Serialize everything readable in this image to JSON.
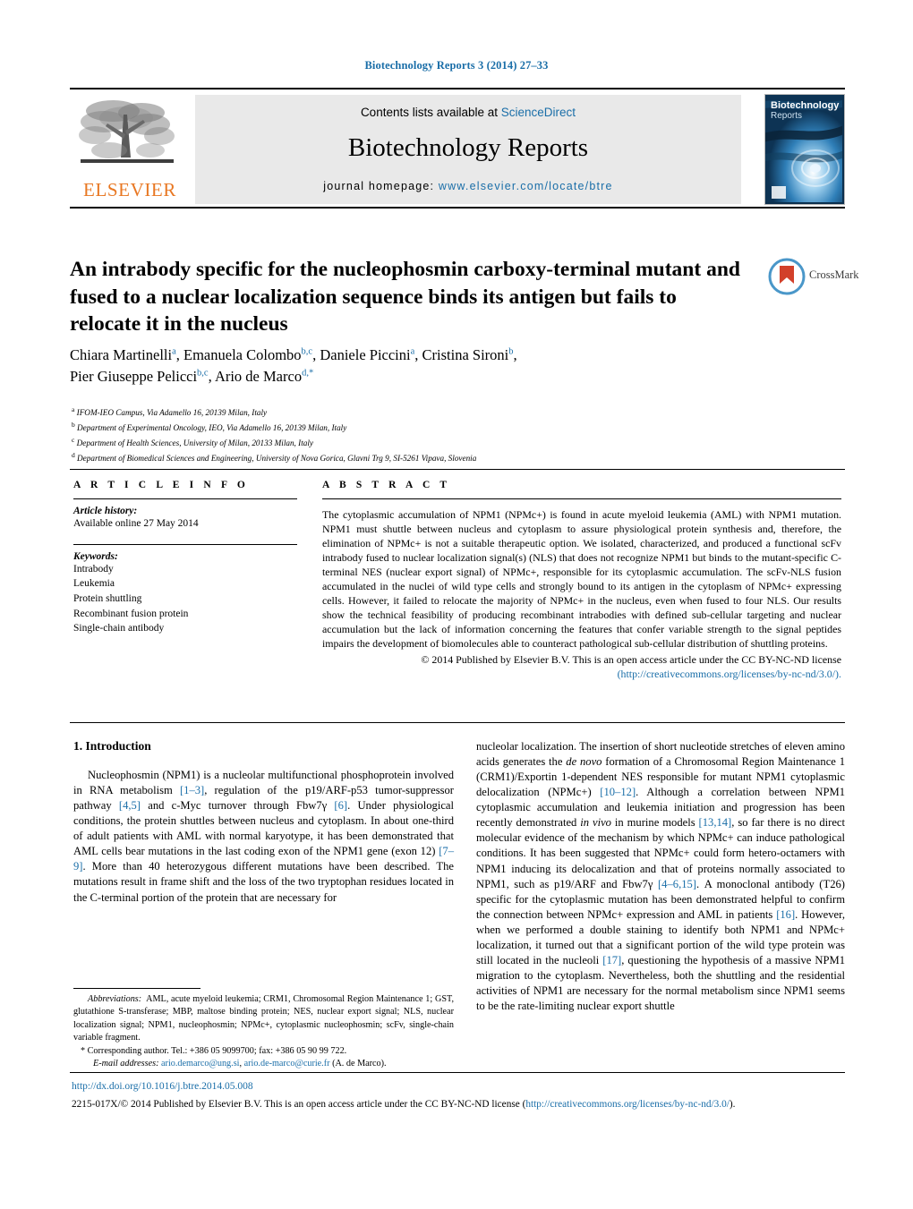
{
  "running_head": "Biotechnology Reports 3 (2014) 27–33",
  "masthead": {
    "publisher_name": "ELSEVIER",
    "contents_prefix": "Contents lists available at ",
    "contents_link": "ScienceDirect",
    "journal_title": "Biotechnology Reports",
    "homepage_label": "journal homepage:",
    "homepage_url": "www.elsevier.com/locate/btre",
    "cover_title_line1": "Biotechnology",
    "cover_title_line2": "Reports"
  },
  "article": {
    "title": "An intrabody specific for the nucleophosmin carboxy-terminal mutant and fused to a nuclear localization sequence binds its antigen but fails to relocate it in the nucleus",
    "crossmark_label": "CrossMark",
    "authors_line1_parts": [
      {
        "name": "Chiara Martinelli",
        "sup": "a",
        "sep": ", "
      },
      {
        "name": "Emanuela Colombo",
        "sup": "b,c",
        "sep": ", "
      },
      {
        "name": "Daniele Piccini",
        "sup": "a",
        "sep": ", "
      },
      {
        "name": "Cristina Sironi",
        "sup": "b",
        "sep": ","
      }
    ],
    "authors_line2_parts": [
      {
        "name": "Pier Giuseppe Pelicci",
        "sup": "b,c",
        "sep": ", "
      },
      {
        "name": "Ario de Marco",
        "sup": "d,*",
        "sep": ""
      }
    ],
    "affiliations": [
      {
        "mark": "a",
        "text": "IFOM-IEO Campus, Via Adamello 16, 20139 Milan, Italy"
      },
      {
        "mark": "b",
        "text": "Department of Experimental Oncology, IEO, Via Adamello 16, 20139 Milan, Italy"
      },
      {
        "mark": "c",
        "text": "Department of Health Sciences, University of Milan, 20133 Milan, Italy"
      },
      {
        "mark": "d",
        "text": "Department of Biomedical Sciences and Engineering, University of Nova Gorica, Glavni Trg 9, SI-5261 Vipava, Slovenia"
      }
    ]
  },
  "article_info": {
    "heading": "A R T I C L E   I N F O",
    "history_label": "Article history:",
    "history_value": "Available online 27 May 2014",
    "keywords_label": "Keywords:",
    "keywords": [
      "Intrabody",
      "Leukemia",
      "Protein shuttling",
      "Recombinant fusion protein",
      "Single-chain antibody"
    ]
  },
  "abstract": {
    "heading": "A B S T R A C T",
    "text": "The cytoplasmic accumulation of NPM1 (NPMc+) is found in acute myeloid leukemia (AML) with NPM1 mutation. NPM1 must shuttle between nucleus and cytoplasm to assure physiological protein synthesis and, therefore, the elimination of NPMc+ is not a suitable therapeutic option. We isolated, characterized, and produced a functional scFv intrabody fused to nuclear localization signal(s) (NLS) that does not recognize NPM1 but binds to the mutant-specific C-terminal NES (nuclear export signal) of NPMc+, responsible for its cytoplasmic accumulation. The scFv-NLS fusion accumulated in the nuclei of wild type cells and strongly bound to its antigen in the cytoplasm of NPMc+ expressing cells. However, it failed to relocate the majority of NPMc+ in the nucleus, even when fused to four NLS. Our results show the technical feasibility of producing recombinant intrabodies with defined sub-cellular targeting and nuclear accumulation but the lack of information concerning the features that confer variable strength to the signal peptides impairs the development of biomolecules able to counteract pathological sub-cellular distribution of shuttling proteins.",
    "copyright": "© 2014 Published by Elsevier B.V. This is an open access article under the CC BY-NC-ND license",
    "license_url": "(http://creativecommons.org/licenses/by-nc-nd/3.0/)."
  },
  "introduction": {
    "heading": "1.  Introduction",
    "left_paragraph": "Nucleophosmin (NPM1) is a nucleolar multifunctional phosphoprotein involved in RNA metabolism [1–3], regulation of the p19/ARF-p53 tumor-suppressor pathway [4,5] and c-Myc turnover through Fbw7γ [6]. Under physiological conditions, the protein shuttles between nucleus and cytoplasm. In about one-third of adult patients with AML with normal karyotype, it has been demonstrated that AML cells bear mutations in the last coding exon of the NPM1 gene (exon 12) [7–9]. More than 40 heterozygous different mutations have been described. The mutations result in frame shift and the loss of the two tryptophan residues located in the C-terminal portion of the protein that are necessary for",
    "right_paragraph": "nucleolar localization. The insertion of short nucleotide stretches of eleven amino acids generates the de novo formation of a Chromosomal Region Maintenance 1 (CRM1)/Exportin 1-dependent NES responsible for mutant NPM1 cytoplasmic delocalization (NPMc+) [10–12]. Although a correlation between NPM1 cytoplasmic accumulation and leukemia initiation and progression has been recently demonstrated in vivo in murine models [13,14], so far there is no direct molecular evidence of the mechanism by which NPMc+ can induce pathological conditions. It has been suggested that NPMc+ could form hetero-octamers with NPM1 inducing its delocalization and that of proteins normally associated to NPM1, such as p19/ARF and Fbw7γ [4–6,15]. A monoclonal antibody (T26) specific for the cytoplasmic mutation has been demonstrated helpful to confirm the connection between NPMc+ expression and AML in patients [16]. However, when we performed a double staining to identify both NPM1 and NPMc+ localization, it turned out that a significant portion of the wild type protein was still located in the nucleoli [17], questioning the hypothesis of a massive NPM1 migration to the cytoplasm. Nevertheless, both the shuttling and the residential activities of NPM1 are necessary for the normal metabolism since NPM1 seems to be the rate-limiting nuclear export shuttle"
  },
  "footnotes": {
    "abbrev_label": "Abbreviations:",
    "abbrev_text": "AML, acute myeloid leukemia; CRM1, Chromosomal Region Maintenance 1; GST, glutathione S-transferase; MBP, maltose binding protein; NES, nuclear export signal; NLS, nuclear localization signal; NPM1, nucleophosmin; NPMc+, cytoplasmic nucleophosmin; scFv, single-chain variable fragment.",
    "corresponding": "* Corresponding author. Tel.: +386 05 9099700; fax: +386 05 90 99 722.",
    "email_label": "E-mail addresses:",
    "email1": "ario.demarco@ung.si",
    "email2": "ario.de-marco@curie.fr",
    "email_suffix": " (A. de Marco)."
  },
  "footer": {
    "doi": "http://dx.doi.org/10.1016/j.btre.2014.05.008",
    "issn_text": "2215-017X/© 2014 Published by Elsevier B.V. This is an open access article under the CC BY-NC-ND license (",
    "issn_link": "http://creativecommons.org/licenses/by-nc-nd/3.0/",
    "issn_tail": ")."
  },
  "colors": {
    "link": "#1a6ea8",
    "elsevier_orange": "#E87722",
    "banner_grey": "#e9e9e9"
  }
}
